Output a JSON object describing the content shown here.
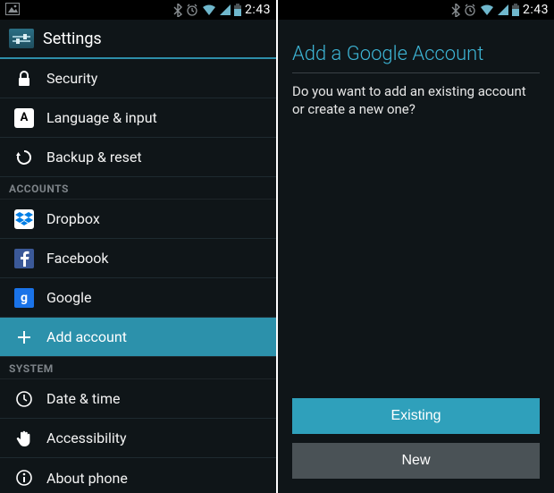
{
  "status": {
    "time": "2:43"
  },
  "left": {
    "header_title": "Settings",
    "rows": {
      "security": "Security",
      "language": "Language & input",
      "backup": "Backup & reset",
      "dropbox": "Dropbox",
      "facebook": "Facebook",
      "google": "Google",
      "add_account": "Add account",
      "date_time": "Date & time",
      "accessibility": "Accessibility",
      "about": "About phone"
    },
    "section_accounts": "ACCOUNTS",
    "section_system": "SYSTEM"
  },
  "right": {
    "title": "Add a Google Account",
    "prompt": "Do you want to add an existing account or create a new one?",
    "existing_label": "Existing",
    "new_label": "New"
  }
}
